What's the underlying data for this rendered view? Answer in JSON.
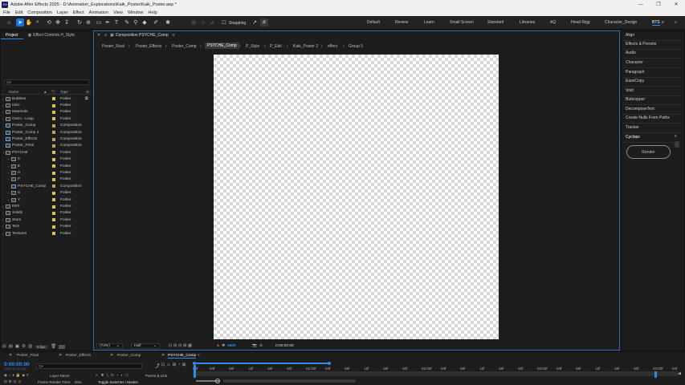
{
  "window": {
    "title": "Adobe After Effects 2025 - D:\\Animation_Explorations\\Kaik_Poster\\Kaik_Poster.aep *",
    "logo": "Ae"
  },
  "menu": [
    "File",
    "Edit",
    "Composition",
    "Layer",
    "Effect",
    "Animation",
    "View",
    "Window",
    "Help"
  ],
  "toolbar": {
    "snapping_label": "Snapping"
  },
  "workspaces": [
    "Default",
    "Review",
    "Learn",
    "Small Screen",
    "Standard",
    "Libraries",
    "AQ",
    "Head Rigg",
    "Character_Design",
    "BTS"
  ],
  "workspace_active": "BTS",
  "project_panel": {
    "tabs": [
      "Project",
      "Effect Controls H_Style"
    ],
    "search_placeholder": "Q▾",
    "columns": {
      "name": "Name",
      "type": "Type",
      "size": "Si"
    },
    "items": [
      {
        "name": "Bubbles",
        "type": "Folder",
        "depth": 0,
        "expanded": false,
        "kind": "folder",
        "label": "#d9c54a"
      },
      {
        "name": "Intro",
        "type": "Folder",
        "depth": 0,
        "expanded": false,
        "kind": "folder",
        "label": "#d9c54a"
      },
      {
        "name": "Materials",
        "type": "Folder",
        "depth": 0,
        "expanded": false,
        "kind": "folder",
        "label": "#d9c54a"
      },
      {
        "name": "Outro - Loop",
        "type": "Folder",
        "depth": 0,
        "expanded": false,
        "kind": "folder",
        "label": "#d9c54a"
      },
      {
        "name": "Poster_Comp",
        "type": "Composition",
        "depth": 0,
        "kind": "comp",
        "label": "#b9a25a"
      },
      {
        "name": "Poster_Comp 2",
        "type": "Composition",
        "depth": 0,
        "kind": "comp",
        "label": "#b9a25a"
      },
      {
        "name": "Poster_Effects",
        "type": "Composition",
        "depth": 0,
        "kind": "comp",
        "label": "#b9a25a"
      },
      {
        "name": "Poster_Final",
        "type": "Composition",
        "depth": 0,
        "kind": "comp",
        "label": "#b9a25a"
      },
      {
        "name": "PSYCHE",
        "type": "Folder",
        "depth": 0,
        "expanded": true,
        "kind": "folder",
        "label": "#d9c54a"
      },
      {
        "name": "C",
        "type": "Folder",
        "depth": 1,
        "expanded": false,
        "kind": "folder",
        "label": "#d9c54a"
      },
      {
        "name": "E",
        "type": "Folder",
        "depth": 1,
        "expanded": false,
        "kind": "folder",
        "label": "#d9c54a"
      },
      {
        "name": "H",
        "type": "Folder",
        "depth": 1,
        "expanded": false,
        "kind": "folder",
        "label": "#d9c54a"
      },
      {
        "name": "P",
        "type": "Folder",
        "depth": 1,
        "expanded": false,
        "kind": "folder",
        "label": "#d9c54a"
      },
      {
        "name": "PSYCHE_Comp",
        "type": "Composition",
        "depth": 1,
        "kind": "comp",
        "label": "#b9a25a"
      },
      {
        "name": "S",
        "type": "Folder",
        "depth": 1,
        "expanded": false,
        "kind": "folder",
        "label": "#d9c54a"
      },
      {
        "name": "Y",
        "type": "Folder",
        "depth": 1,
        "expanded": false,
        "kind": "folder",
        "label": "#d9c54a"
      },
      {
        "name": "REF",
        "type": "Folder",
        "depth": 0,
        "expanded": false,
        "kind": "folder",
        "label": "#d9c54a"
      },
      {
        "name": "Solids",
        "type": "Folder",
        "depth": 0,
        "expanded": false,
        "kind": "folder",
        "label": "#d9c54a"
      },
      {
        "name": "Stars",
        "type": "Folder",
        "depth": 0,
        "expanded": false,
        "kind": "folder",
        "label": "#d9c54a"
      },
      {
        "name": "Text",
        "type": "Folder",
        "depth": 0,
        "expanded": false,
        "kind": "folder",
        "label": "#d9c54a"
      },
      {
        "name": "Textures",
        "type": "Folder",
        "depth": 0,
        "expanded": false,
        "kind": "folder",
        "label": "#d9c54a"
      }
    ],
    "bpc": "8 bpc"
  },
  "composition_panel": {
    "tab": "Composition PSYCHE_Comp",
    "breadcrumbs": [
      "Poster_Final",
      "Poster_Effects",
      "Poster_Comp",
      "PSYCHE_Comp",
      "P_Style",
      "P_Edit",
      "Kaik_Poster 2",
      "effect",
      "Group 5"
    ],
    "breadcrumb_active": "PSYCHE_Comp",
    "zoom": "(74%)",
    "resolution": "Half",
    "hdr": "HDR",
    "timecode": "0:00:00:00"
  },
  "right_panels": [
    "Align",
    "Effects & Presets",
    "Audio",
    "Character",
    "Paragraph",
    "EaseCopy",
    "Void",
    "Buttcopper",
    "DecomposeText",
    "Create Nulls From Paths",
    "Tracker",
    "Cyclops"
  ],
  "cyclops": {
    "render_label": "Render"
  },
  "timeline": {
    "tabs": [
      "Poster_Final",
      "Poster_Effects",
      "Poster_Comp",
      "PSYCHE_Comp"
    ],
    "active_tab": "PSYCHE_Comp",
    "timecode": "0:00:00:00",
    "timecode_sub": "00000 (12.00 fps)",
    "search_placeholder": "Q▾",
    "layer_name_header": "Layer Name",
    "parent_header": "Parent & Link",
    "ticks": [
      "00f",
      "04f",
      "08f",
      "12f",
      "16f",
      "20f",
      "01:00f",
      "04f",
      "08f",
      "12f",
      "16f",
      "20f",
      "02:00f",
      "04f",
      "08f",
      "12f",
      "16f",
      "20f",
      "03:00f",
      "04f",
      "08f",
      "12f",
      "16f",
      "20f",
      "04:00f",
      "04f",
      "08f"
    ],
    "frame_render_label": "Frame Render Time:",
    "frame_render_value": "0ms",
    "toggle_label": "Toggle Switches / Modes"
  },
  "colors": {
    "accent": "#2d8ceb",
    "folder_label": "#d9c54a"
  }
}
